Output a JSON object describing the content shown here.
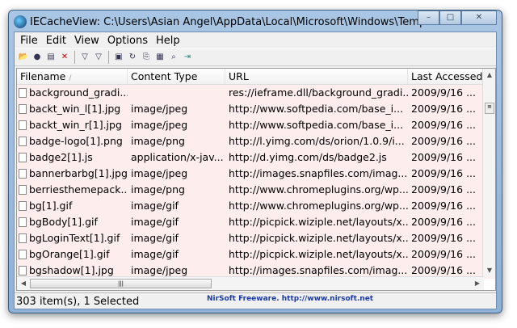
{
  "window": {
    "title": "IECacheView:  C:\\Users\\Asian Angel\\AppData\\Local\\Microsoft\\Windows\\Temp...",
    "minimize": "–",
    "maximize": "□",
    "close": "✕"
  },
  "menu": [
    "File",
    "Edit",
    "View",
    "Options",
    "Help"
  ],
  "toolbar": [
    {
      "icon": "open-folder-icon",
      "glyph": "📂"
    },
    {
      "icon": "globe-icon",
      "glyph": "●"
    },
    {
      "icon": "copy-files-icon",
      "glyph": "▤"
    },
    {
      "icon": "delete-icon",
      "glyph": "✕"
    },
    {
      "icon": "filter-icon",
      "glyph": "▽"
    },
    {
      "icon": "filter-off-icon",
      "glyph": "▽"
    },
    {
      "icon": "save-icon",
      "glyph": "▣"
    },
    {
      "icon": "refresh-icon",
      "glyph": "↻"
    },
    {
      "icon": "copy-icon",
      "glyph": "⎘"
    },
    {
      "icon": "properties-icon",
      "glyph": "▦"
    },
    {
      "icon": "find-icon",
      "glyph": "⌕"
    },
    {
      "icon": "exit-icon",
      "glyph": "⇥"
    }
  ],
  "columns": [
    "Filename",
    "Content Type",
    "URL",
    "Last Accessed"
  ],
  "sort_indicator": "/",
  "rows": [
    [
      "background_gradi...",
      "",
      "res://ieframe.dll/background_gradi...",
      "2009/9/16 ..."
    ],
    [
      "backt_win_l[1].jpg",
      "image/jpeg",
      "http://www.softpedia.com/base_i...",
      "2009/9/16 ..."
    ],
    [
      "backt_win_r[1].jpg",
      "image/jpeg",
      "http://www.softpedia.com/base_i...",
      "2009/9/16 ..."
    ],
    [
      "badge-logo[1].png",
      "image/png",
      "http://l.yimg.com/ds/orion/1.0.9/i...",
      "2009/9/16 ..."
    ],
    [
      "badge2[1].js",
      "application/x-jav...",
      "http://d.yimg.com/ds/badge2.js",
      "2009/9/16 ..."
    ],
    [
      "bannerbarbg[1].jpg",
      "image/jpeg",
      "http://images.snapfiles.com/imag...",
      "2009/9/16 ..."
    ],
    [
      "berriesthemepack...",
      "image/png",
      "http://www.chromeplugins.org/wp...",
      "2009/9/16 ..."
    ],
    [
      "bg[1].gif",
      "image/gif",
      "http://www.chromeplugins.org/wp...",
      "2009/9/16 ..."
    ],
    [
      "bgBody[1].gif",
      "image/gif",
      "http://picpick.wiziple.net/layouts/x...",
      "2009/9/16 ..."
    ],
    [
      "bgLoginText[1].gif",
      "image/gif",
      "http://picpick.wiziple.net/layouts/x...",
      "2009/9/16 ..."
    ],
    [
      "bgOrange[1].gif",
      "image/gif",
      "http://picpick.wiziple.net/layouts/x...",
      "2009/9/16 ..."
    ],
    [
      "bgshadow[1].jpg",
      "image/jpeg",
      "http://images.snapfiles.com/imag...",
      "2009/9/16 ..."
    ]
  ],
  "status": {
    "count": "303 item(s), 1 Selected",
    "credit": "NirSoft Freeware.  http://www.nirsoft.net"
  }
}
